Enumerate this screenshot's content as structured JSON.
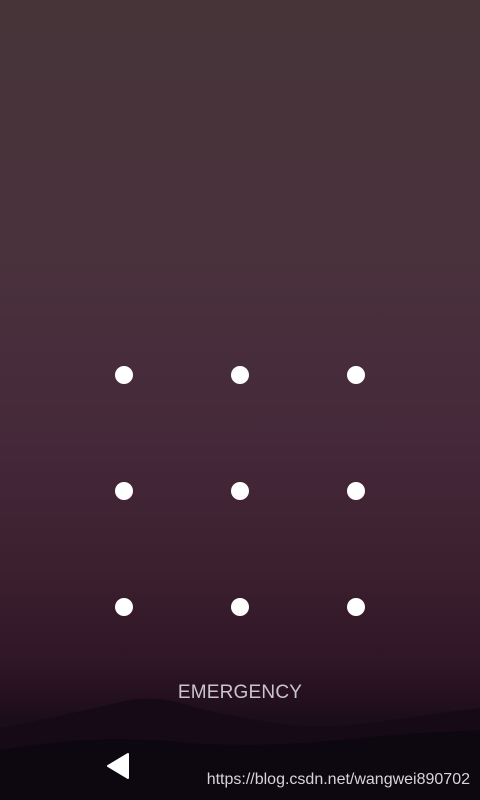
{
  "lock_screen": {
    "pattern_dots": [
      {
        "row": 1,
        "col": 1
      },
      {
        "row": 1,
        "col": 2
      },
      {
        "row": 1,
        "col": 3
      },
      {
        "row": 2,
        "col": 1
      },
      {
        "row": 2,
        "col": 2
      },
      {
        "row": 2,
        "col": 3
      },
      {
        "row": 3,
        "col": 1
      },
      {
        "row": 3,
        "col": 2
      },
      {
        "row": 3,
        "col": 3
      }
    ],
    "emergency_label": "EMERGENCY",
    "dot_color": "#ffffff"
  },
  "navigation": {
    "back_icon": "back-triangle-icon"
  },
  "watermark": {
    "text": "https://blog.csdn.net/wangwei890702"
  },
  "colors": {
    "background_top": "#463439",
    "background_bottom": "#0f0a14",
    "emergency_text": "#cbc4cc"
  }
}
